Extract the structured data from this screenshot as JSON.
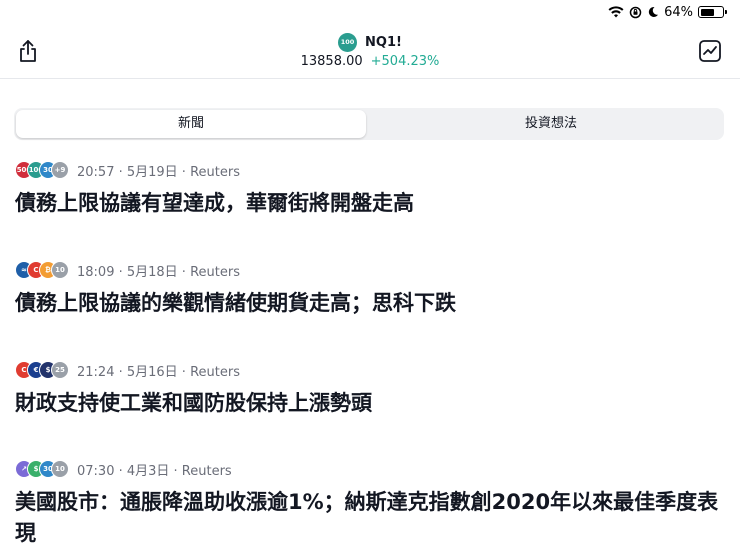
{
  "status": {
    "battery": "64%",
    "battery_level": 0.64
  },
  "header": {
    "symbol_badge": "100",
    "symbol": "NQ1!",
    "price": "13858.00",
    "change": "+504.23%"
  },
  "tabs": [
    {
      "label": "新聞",
      "active": true
    },
    {
      "label": "投資想法",
      "active": false
    }
  ],
  "news": [
    {
      "time": "20:57 · 5月19日 · Reuters",
      "headline": "債務上限協議有望達成，華爾街將開盤走高",
      "icons": [
        {
          "label": "500",
          "color": "#d12e3c"
        },
        {
          "label": "100",
          "color": "#2a9d8f"
        },
        {
          "label": "30",
          "color": "#2f88c9"
        },
        {
          "label": "+9",
          "color": "#9aa0a8"
        }
      ]
    },
    {
      "time": "18:09 · 5月18日 · Reuters",
      "headline": "債務上限協議的樂觀情緒使期貨走高；思科下跌",
      "icons": [
        {
          "label": "≈",
          "color": "#1f5fa8"
        },
        {
          "label": "C",
          "color": "#e03c31"
        },
        {
          "label": "₿",
          "color": "#f39c33"
        },
        {
          "label": "10",
          "color": "#9aa0a8"
        }
      ]
    },
    {
      "time": "21:24 · 5月16日 · Reuters",
      "headline": "財政支持使工業和國防股保持上漲勢頭",
      "icons": [
        {
          "label": "C",
          "color": "#e03c31"
        },
        {
          "label": "€",
          "color": "#1a3f8f"
        },
        {
          "label": "$",
          "color": "#22336b"
        },
        {
          "label": "25",
          "color": "#9aa0a8"
        }
      ]
    },
    {
      "time": "07:30 · 4月3日 · Reuters",
      "headline": "美國股市：通脹降溫助收漲逾1%；納斯達克指數創2020年以來最佳季度表現",
      "icons": [
        {
          "label": "↗",
          "color": "#7b6bd6"
        },
        {
          "label": "$",
          "color": "#3bb06b"
        },
        {
          "label": "30",
          "color": "#2f88c9"
        },
        {
          "label": "10",
          "color": "#9aa0a8"
        }
      ]
    }
  ]
}
